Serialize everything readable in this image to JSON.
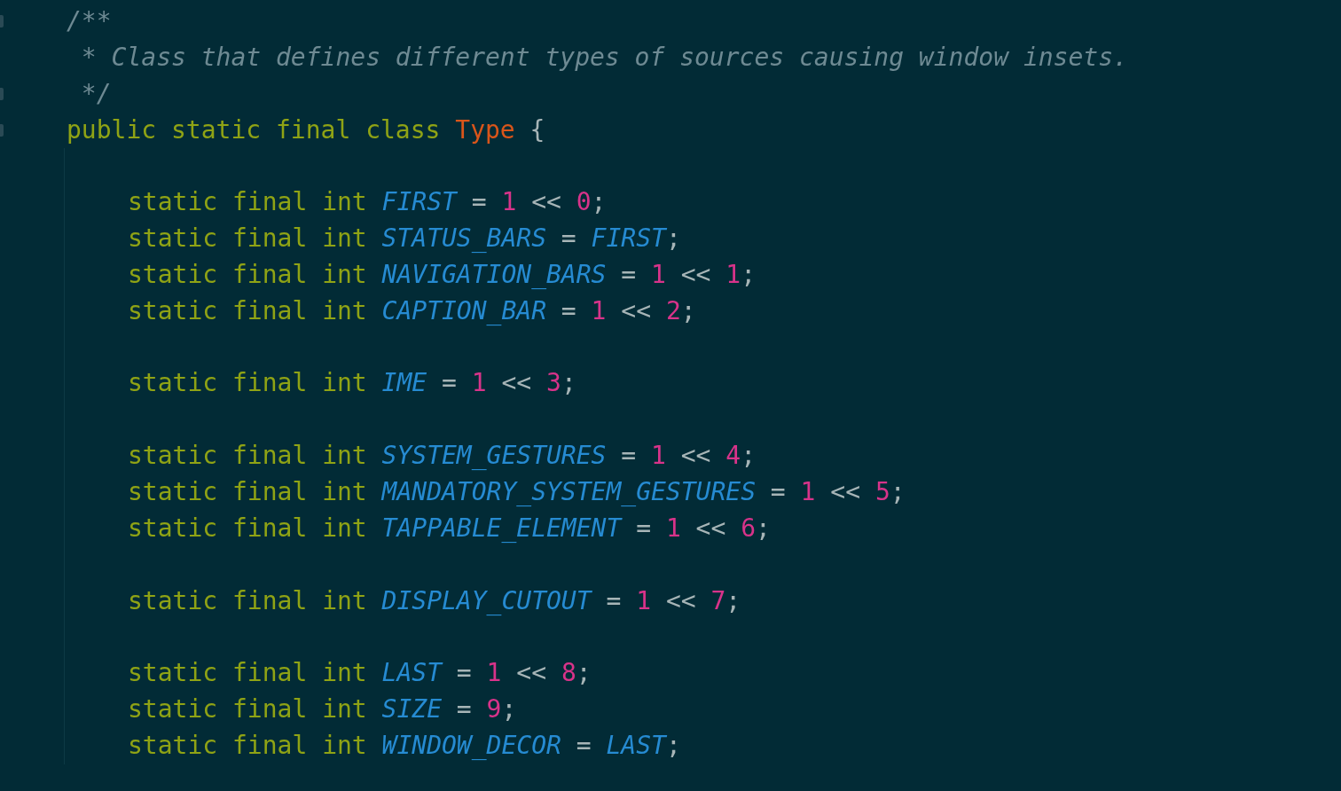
{
  "editor": {
    "comment": [
      "/**",
      " * Class that defines different types of sources causing window insets.",
      " */"
    ],
    "class_line": {
      "tokens": [
        {
          "kind": "keyword",
          "text": "public static final class "
        },
        {
          "kind": "type",
          "text": "Type"
        },
        {
          "kind": "operator",
          "text": " {"
        }
      ]
    },
    "blocks": [
      {
        "lines": [
          {
            "tokens": [
              {
                "kind": "keyword",
                "text": "static final int "
              },
              {
                "kind": "identifier",
                "text": "FIRST"
              },
              {
                "kind": "operator",
                "text": " = "
              },
              {
                "kind": "number",
                "text": "1"
              },
              {
                "kind": "operator",
                "text": " << "
              },
              {
                "kind": "number",
                "text": "0"
              },
              {
                "kind": "operator",
                "text": ";"
              }
            ]
          },
          {
            "tokens": [
              {
                "kind": "keyword",
                "text": "static final int "
              },
              {
                "kind": "identifier",
                "text": "STATUS_BARS"
              },
              {
                "kind": "operator",
                "text": " = "
              },
              {
                "kind": "identifier",
                "text": "FIRST"
              },
              {
                "kind": "operator",
                "text": ";"
              }
            ]
          },
          {
            "tokens": [
              {
                "kind": "keyword",
                "text": "static final int "
              },
              {
                "kind": "identifier",
                "text": "NAVIGATION_BARS"
              },
              {
                "kind": "operator",
                "text": " = "
              },
              {
                "kind": "number",
                "text": "1"
              },
              {
                "kind": "operator",
                "text": " << "
              },
              {
                "kind": "number",
                "text": "1"
              },
              {
                "kind": "operator",
                "text": ";"
              }
            ]
          },
          {
            "tokens": [
              {
                "kind": "keyword",
                "text": "static final int "
              },
              {
                "kind": "identifier",
                "text": "CAPTION_BAR"
              },
              {
                "kind": "operator",
                "text": " = "
              },
              {
                "kind": "number",
                "text": "1"
              },
              {
                "kind": "operator",
                "text": " << "
              },
              {
                "kind": "number",
                "text": "2"
              },
              {
                "kind": "operator",
                "text": ";"
              }
            ]
          }
        ]
      },
      {
        "lines": [
          {
            "tokens": [
              {
                "kind": "keyword",
                "text": "static final int "
              },
              {
                "kind": "identifier",
                "text": "IME"
              },
              {
                "kind": "operator",
                "text": " = "
              },
              {
                "kind": "number",
                "text": "1"
              },
              {
                "kind": "operator",
                "text": " << "
              },
              {
                "kind": "number",
                "text": "3"
              },
              {
                "kind": "operator",
                "text": ";"
              }
            ]
          }
        ]
      },
      {
        "lines": [
          {
            "tokens": [
              {
                "kind": "keyword",
                "text": "static final int "
              },
              {
                "kind": "identifier",
                "text": "SYSTEM_GESTURES"
              },
              {
                "kind": "operator",
                "text": " = "
              },
              {
                "kind": "number",
                "text": "1"
              },
              {
                "kind": "operator",
                "text": " << "
              },
              {
                "kind": "number",
                "text": "4"
              },
              {
                "kind": "operator",
                "text": ";"
              }
            ]
          },
          {
            "tokens": [
              {
                "kind": "keyword",
                "text": "static final int "
              },
              {
                "kind": "identifier",
                "text": "MANDATORY_SYSTEM_GESTURES"
              },
              {
                "kind": "operator",
                "text": " = "
              },
              {
                "kind": "number",
                "text": "1"
              },
              {
                "kind": "operator",
                "text": " << "
              },
              {
                "kind": "number",
                "text": "5"
              },
              {
                "kind": "operator",
                "text": ";"
              }
            ]
          },
          {
            "tokens": [
              {
                "kind": "keyword",
                "text": "static final int "
              },
              {
                "kind": "identifier",
                "text": "TAPPABLE_ELEMENT"
              },
              {
                "kind": "operator",
                "text": " = "
              },
              {
                "kind": "number",
                "text": "1"
              },
              {
                "kind": "operator",
                "text": " << "
              },
              {
                "kind": "number",
                "text": "6"
              },
              {
                "kind": "operator",
                "text": ";"
              }
            ]
          }
        ]
      },
      {
        "lines": [
          {
            "tokens": [
              {
                "kind": "keyword",
                "text": "static final int "
              },
              {
                "kind": "identifier",
                "text": "DISPLAY_CUTOUT"
              },
              {
                "kind": "operator",
                "text": " = "
              },
              {
                "kind": "number",
                "text": "1"
              },
              {
                "kind": "operator",
                "text": " << "
              },
              {
                "kind": "number",
                "text": "7"
              },
              {
                "kind": "operator",
                "text": ";"
              }
            ]
          }
        ]
      },
      {
        "lines": [
          {
            "tokens": [
              {
                "kind": "keyword",
                "text": "static final int "
              },
              {
                "kind": "identifier",
                "text": "LAST"
              },
              {
                "kind": "operator",
                "text": " = "
              },
              {
                "kind": "number",
                "text": "1"
              },
              {
                "kind": "operator",
                "text": " << "
              },
              {
                "kind": "number",
                "text": "8"
              },
              {
                "kind": "operator",
                "text": ";"
              }
            ]
          },
          {
            "tokens": [
              {
                "kind": "keyword",
                "text": "static final int "
              },
              {
                "kind": "identifier",
                "text": "SIZE"
              },
              {
                "kind": "operator",
                "text": " = "
              },
              {
                "kind": "number",
                "text": "9"
              },
              {
                "kind": "operator",
                "text": ";"
              }
            ]
          },
          {
            "tokens": [
              {
                "kind": "keyword",
                "text": "static final int "
              },
              {
                "kind": "identifier",
                "text": "WINDOW_DECOR"
              },
              {
                "kind": "operator",
                "text": " = "
              },
              {
                "kind": "identifier",
                "text": "LAST"
              },
              {
                "kind": "operator",
                "text": ";"
              }
            ]
          }
        ]
      }
    ]
  }
}
